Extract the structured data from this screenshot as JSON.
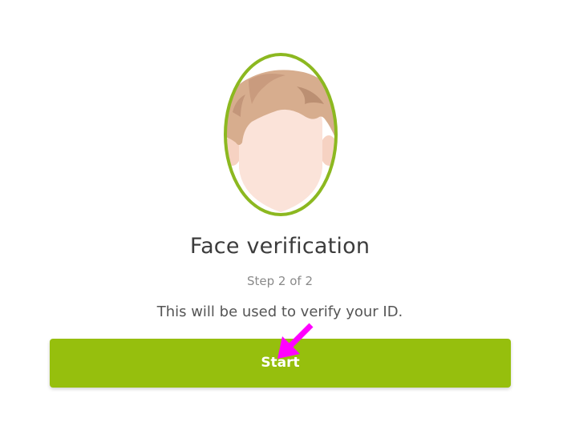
{
  "window": {
    "background_color": "#ffffff"
  },
  "illustration": {
    "icon": "face-outline-icon",
    "oval_color": "#8cb820"
  },
  "content": {
    "title": "Face verification",
    "step_text": "Step 2 of 2",
    "description": "This will be used to verify your ID."
  },
  "actions": {
    "start_label": "Start",
    "start_color": "#96bf0d"
  },
  "annotation": {
    "icon": "arrow-pointer-icon",
    "color": "#ff00ff"
  }
}
